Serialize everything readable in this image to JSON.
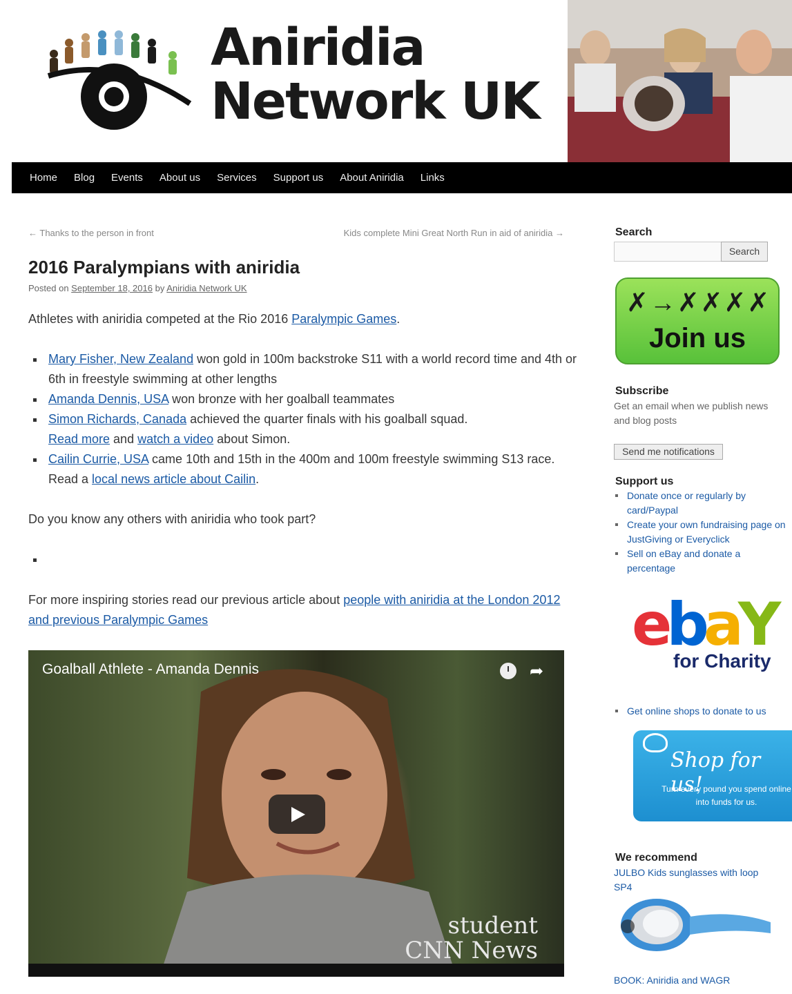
{
  "site": {
    "name_line1": "Aniridia",
    "name_line2": "Network UK"
  },
  "nav": {
    "items": [
      "Home",
      "Blog",
      "Events",
      "About us",
      "Services",
      "Support us",
      "About Aniridia",
      "Links"
    ]
  },
  "post_nav": {
    "prev": "← Thanks to the person in front",
    "next": "Kids complete Mini Great North Run in aid of aniridia →"
  },
  "post": {
    "title": "2016 Paralympians with aniridia",
    "meta_prefix": "Posted on",
    "date": "September 18, 2016",
    "by": "by",
    "author": "Aniridia Network UK",
    "intro_text": "Athletes with aniridia competed at the Rio 2016 ",
    "intro_link": "Paralympic Games",
    "intro_end": ".",
    "athletes": [
      {
        "link": "Mary Fisher, New Zealand",
        "text": " won gold in 100m backstroke S11 with a world record time and 4th or 6th in freestyle swimming at other lengths"
      },
      {
        "link": "Amanda Dennis, USA",
        "text": " won bronze with her goalball teammates"
      },
      {
        "link": "Simon Richards, Canada",
        "text": " achieved the quarter finals with his goalball squad.",
        "extra_link1": "Read more",
        "extra_mid": " and ",
        "extra_link2": "watch a video",
        "extra_end": " about Simon."
      },
      {
        "link": "Cailin Currie, USA",
        "text": " came 10th and 15th in the 400m and 100m freestyle swimming S13 race. Read a ",
        "extra_link1": "local news article about Cailin",
        "extra_end": "."
      }
    ],
    "question": "Do you know any others with aniridia who took part?",
    "more_text": "For more inspiring stories read our previous article about ",
    "more_link": "people with aniridia at the London 2012 and previous Paralympic Games"
  },
  "video": {
    "title": "Goalball Athlete - Amanda Dennis",
    "watermark_line1": "student",
    "watermark_line2": "CNN News"
  },
  "sidebar": {
    "search_title": "Search",
    "search_button": "Search",
    "search_placeholder": "",
    "join_label": "Join us",
    "subscribe_title": "Subscribe",
    "subscribe_text": "Get an email when we publish news and blog posts",
    "notify_button": "Send me notifications",
    "support_title": "Support us",
    "support_items": [
      "Donate once or regularly by card/Paypal",
      "Create your own fundraising page on JustGiving or Everyclick",
      "Sell on eBay and donate a percentage"
    ],
    "ebay_letters": [
      "e",
      "b",
      "a",
      "Y"
    ],
    "ebay_charity": "for Charity",
    "shop_item": "Get online shops to donate to us",
    "shop_title": "Shop for us!",
    "shop_sub": "Turn every pound you spend online into funds for us.",
    "recommend_title": "We recommend",
    "recommend_link": "JULBO Kids sunglasses with loop SP4",
    "book_link": "BOOK: Aniridia and WAGR"
  },
  "colors": {
    "link": "#1b5aa5",
    "nav_bg": "#000000",
    "join_green": "#58c13a",
    "shop_blue": "#1d8fd0"
  }
}
